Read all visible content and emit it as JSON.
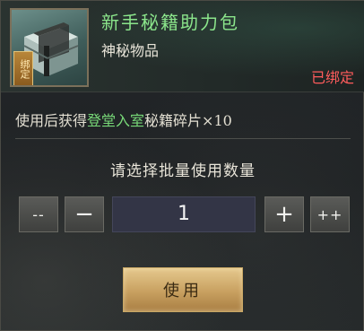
{
  "item": {
    "title": "新手秘籍助力包",
    "category": "神秘物品",
    "bound_tag": "绑定",
    "bound_status": "已绑定"
  },
  "description": {
    "prefix": "使用后获得",
    "highlight": "登堂入室",
    "suffix": "秘籍碎片×10"
  },
  "quantity": {
    "prompt": "请选择批量使用数量",
    "dec_many_label": "--",
    "dec_label": "−",
    "value": "1",
    "inc_label": "+",
    "inc_many_label": "++"
  },
  "actions": {
    "use_label": "使用"
  },
  "colors": {
    "title": "#8be58b",
    "highlight": "#78d978",
    "bound_status": "#ff5c5c",
    "use_button": "#d6b273"
  },
  "icons": {
    "item_icon": "gift-box-icon"
  }
}
